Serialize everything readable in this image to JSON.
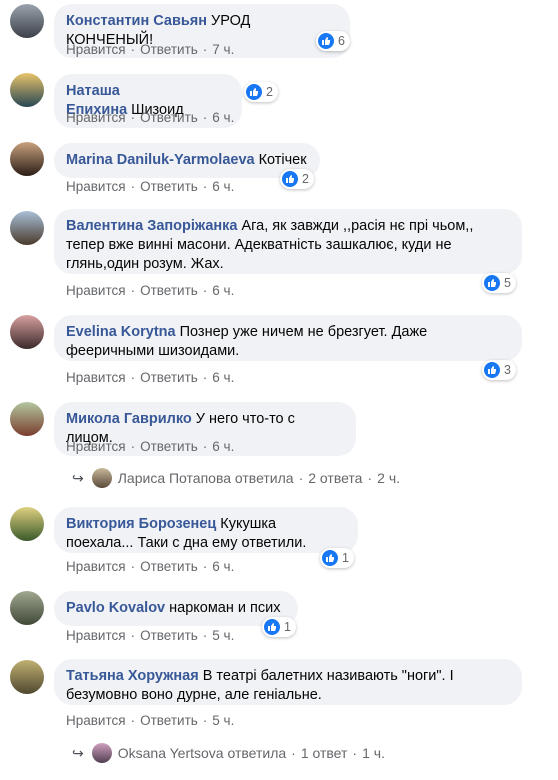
{
  "colors": {
    "author": "#385898",
    "like": "#1877f2",
    "bubble": "#f0f2f5",
    "meta": "#65676b"
  },
  "labels": {
    "like": "Нравится",
    "reply": "Ответить"
  },
  "comments": [
    {
      "author": "Константин Савьян",
      "text": "УРОД КОНЧЕНЫЙ!",
      "likes": "6",
      "time": "7 ч."
    },
    {
      "author": "Наташа Епихина",
      "text": "Шизоид",
      "likes": "2",
      "time": "6 ч."
    },
    {
      "author": "Marina Daniluk-Yarmolaeva",
      "text": "Котічек",
      "likes": "2",
      "time": "6 ч."
    },
    {
      "author": "Валентина Запоріжанка",
      "text": "Ага, як завжди ,,расія нє прі чьом,, тепер вже винні масони. Адекватність зашкалює, куди не глянь,один розум. Жах.",
      "likes": "5",
      "time": "6 ч."
    },
    {
      "author": "Evelina Korytna",
      "text": "Познер уже ничем не брезгует. Даже фееричными шизоидами.",
      "likes": "3",
      "time": "6 ч."
    },
    {
      "author": "Микола Гаврилко",
      "text": "У него что-то с лицом.",
      "likes": "",
      "time": "6 ч.",
      "reply": {
        "name": "Лариса Потапова ответила",
        "count": "2 ответа",
        "time": "2 ч."
      }
    },
    {
      "author": "Виктория Борозенец",
      "text": "Кукушка поехала... Таки с дна ему ответили.",
      "likes": "1",
      "time": "6 ч."
    },
    {
      "author": "Pavlo Kovalov",
      "text": "наркоман и псих",
      "likes": "1",
      "time": "5 ч."
    },
    {
      "author": "Татьяна Хоружная",
      "text": "В театрі балетних називають \"ноги\". І безумовно воно дурне, але геніальне.",
      "likes": "",
      "time": "5 ч.",
      "reply": {
        "name": "Oksana Yertsova ответила",
        "count": "1 ответ",
        "time": "1 ч."
      }
    }
  ]
}
